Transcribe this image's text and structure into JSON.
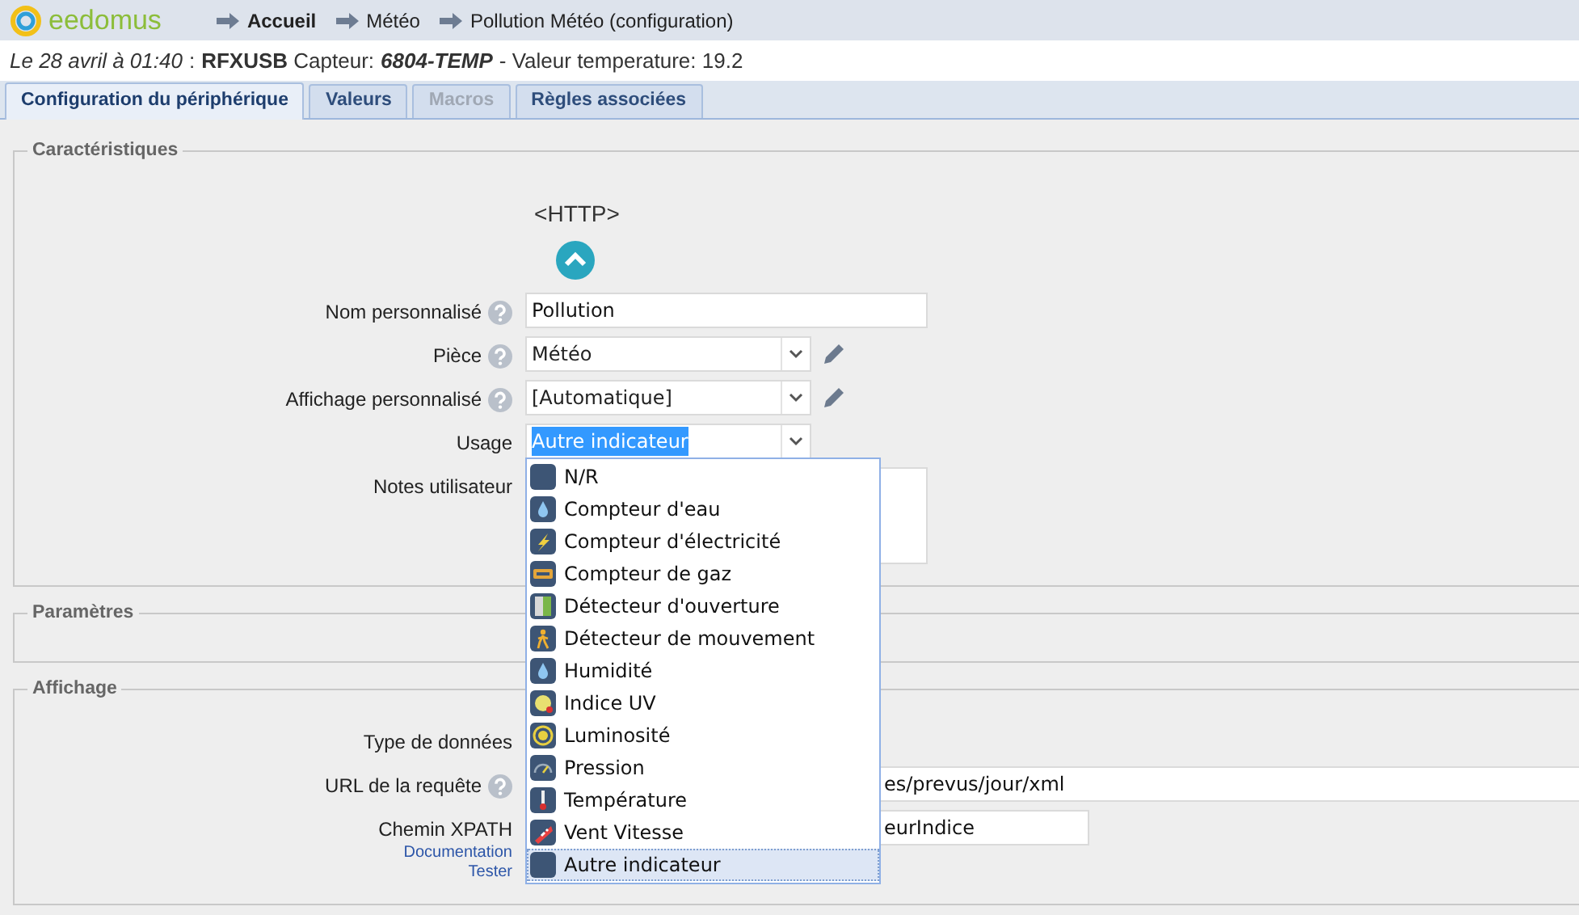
{
  "header": {
    "logo": "eedomus",
    "breadcrumb": [
      {
        "label": "Accueil",
        "kind": "home"
      },
      {
        "label": "Météo",
        "kind": "page"
      },
      {
        "label": "Pollution Météo (configuration)",
        "kind": "page"
      }
    ]
  },
  "status": {
    "date": "Le 28 avril à 01:40",
    "separator": ":",
    "text": "**RFXUSB** Capteur:",
    "sensor": "6804-TEMP",
    "reading": "- Valeur temperature: 19.2"
  },
  "tabs": [
    {
      "label": "Configuration du périphérique",
      "selected": true,
      "disabled": false
    },
    {
      "label": "Valeurs",
      "selected": false,
      "disabled": false
    },
    {
      "label": "Macros",
      "selected": false,
      "disabled": true
    },
    {
      "label": "Règles associées",
      "selected": false,
      "disabled": false
    }
  ],
  "device_type": "<HTTP>",
  "sections": [
    {
      "legend": "Caractéristiques",
      "fields": [
        {
          "label": "Nom personnalisé",
          "help": true,
          "kind": "text",
          "value": "Pollution"
        },
        {
          "label": "Pièce",
          "help": true,
          "kind": "select",
          "value": "Météo",
          "editable": true
        },
        {
          "label": "Affichage personnalisé",
          "help": true,
          "kind": "select",
          "value": "[Automatique]",
          "editable": true
        },
        {
          "label": "Usage",
          "help": false,
          "kind": "select",
          "value": "Autre indicateur",
          "editable": false,
          "highlighted": true,
          "open": true
        },
        {
          "label": "Notes utilisateur",
          "help": false,
          "kind": "textarea"
        }
      ]
    },
    {
      "legend": "Paramètres"
    },
    {
      "legend": "Affichage",
      "fields": [
        {
          "label": "Type de données",
          "help": false,
          "kind": "covered"
        },
        {
          "label": "URL de la requête",
          "help": true,
          "kind": "wide-text",
          "value": "es/prevus/jour/xml"
        },
        {
          "label": "Chemin XPATH",
          "help": false,
          "kind": "text",
          "value": "eurIndice",
          "links": [
            "Documentation",
            "Tester"
          ]
        }
      ]
    }
  ],
  "usage_dropdown": {
    "options": [
      {
        "label": "N/R",
        "kind": "blank",
        "selected": false
      },
      {
        "label": "Compteur d'eau",
        "kind": "drop",
        "selected": false
      },
      {
        "label": "Compteur d'électricité",
        "kind": "bolt",
        "selected": false
      },
      {
        "label": "Compteur de gaz",
        "kind": "meter",
        "selected": false
      },
      {
        "label": "Détecteur d'ouverture",
        "kind": "door",
        "selected": false
      },
      {
        "label": "Détecteur de mouvement",
        "kind": "walker",
        "selected": false
      },
      {
        "label": "Humidité",
        "kind": "drop",
        "selected": false
      },
      {
        "label": "Indice UV",
        "kind": "sun",
        "selected": false
      },
      {
        "label": "Luminosité",
        "kind": "bulb",
        "selected": false
      },
      {
        "label": "Pression",
        "kind": "gauge",
        "selected": false
      },
      {
        "label": "Température",
        "kind": "thermometer",
        "selected": false
      },
      {
        "label": "Vent Vitesse",
        "kind": "windsock",
        "selected": false
      },
      {
        "label": "Autre indicateur",
        "kind": "blank",
        "selected": true
      }
    ]
  }
}
